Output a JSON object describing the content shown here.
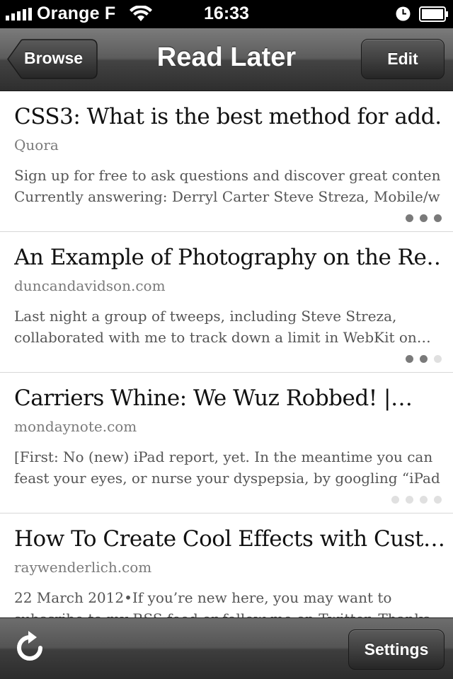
{
  "status_bar": {
    "carrier": "Orange F",
    "time": "16:33",
    "icons": [
      "signal-icon",
      "wifi-icon",
      "clock-icon",
      "battery-icon"
    ]
  },
  "nav": {
    "back_label": "Browse",
    "title": "Read Later",
    "edit_label": "Edit"
  },
  "items": [
    {
      "title": "CSS3: What is the best method for add…",
      "domain": "Quora",
      "excerpt_line1": " Sign up for free to ask questions and discover great content.",
      "excerpt_line2": "Currently answering: Derryl Carter Steve Streza, Mobile/w…",
      "dots": [
        "dark",
        "dark",
        "dark"
      ]
    },
    {
      "title": "An Example of Photography on the Re…",
      "domain": "duncandavidson.com",
      "excerpt_line1": "Last night a group of tweeps, including Steve Streza,",
      "excerpt_line2": "collaborated with me to track down a limit in WebKit on…",
      "dots": [
        "dark",
        "dark",
        "light"
      ]
    },
    {
      "title": "Carriers Whine: We Wuz Robbed! |…",
      "domain": "mondaynote.com",
      "excerpt_line1": "[First: No (new) iPad report, yet. In the meantime you can",
      "excerpt_line2": "feast your eyes, or nurse your dyspepsia, by googling “iPad…",
      "dots": [
        "light",
        "light",
        "light",
        "light"
      ]
    },
    {
      "title": "How To Create Cool Effects with Cust…",
      "domain": "raywenderlich.com",
      "excerpt_line1": "22 March 2012•If you’re new here, you may want to",
      "excerpt_line2": "subscribe to my RSS feed or follow me on Twitter. Thanks…",
      "dots": []
    }
  ],
  "toolbar": {
    "settings_label": "Settings",
    "refresh_icon": "refresh-icon"
  },
  "colors": {
    "bar_dark": "#2e2e2e",
    "bar_light": "#7b7b7b",
    "dot_dark": "#7a7a7a",
    "dot_light": "#e0e0e0"
  }
}
